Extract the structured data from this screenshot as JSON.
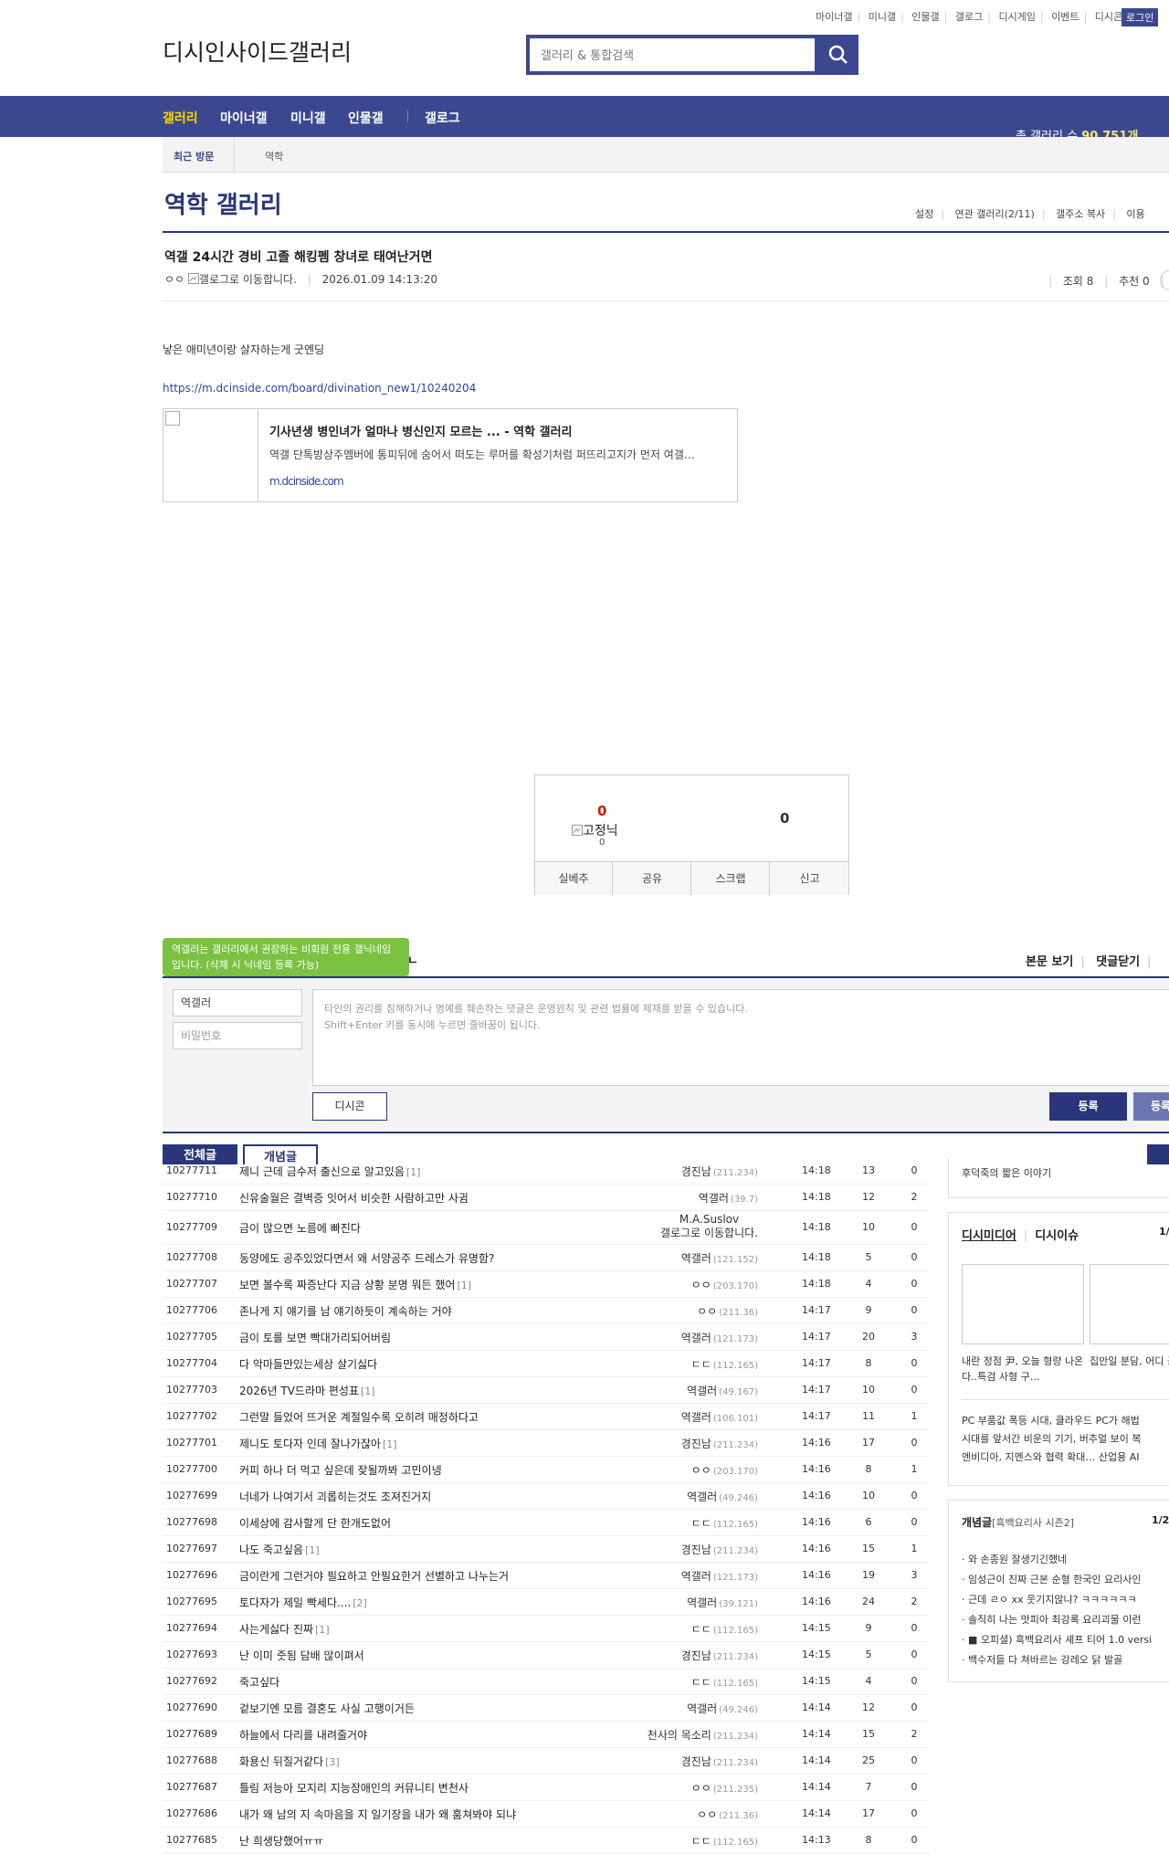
{
  "top_links": [
    "마이너갤",
    "미니갤",
    "인물갤",
    "갤로그",
    "디시게임",
    "이벤트",
    "디시콘"
  ],
  "login_label": "로그인",
  "logo_text": "디시인사이드갤러리",
  "search": {
    "placeholder": "갤러리 & 통합검색"
  },
  "nav": {
    "items": [
      "갤러리",
      "마이너갤",
      "미니갤",
      "인물갤",
      "갤로그"
    ],
    "gallery_count_label": "총 갤러리 수",
    "gallery_count": "90,751개"
  },
  "recent": {
    "label": "최근 방문",
    "value": "역학"
  },
  "gallery_title": "역학 갤러리",
  "title_links": [
    "설정",
    "연관 갤러리(2/11)",
    "갤주소 복사",
    "이용"
  ],
  "post": {
    "title": "역갤 24시간 경비 고졸 해킹펨 창녀로 태여난거면",
    "writer": "ㅇㅇ",
    "gallog_alt": "갤로그로 이동합니다.",
    "date": "2026.01.09 14:13:20",
    "views": "조회 8",
    "recommend": "추천 0",
    "body": "낳은 애미년이랑 살자하는게 굿엔딩",
    "link": "https://m.dcinside.com/board/divination_new1/10240204",
    "og": {
      "title": "기사년생 병인녀가 얼마나 병신인지 모르는 ... - 역학 갤러리",
      "desc": "역갤 단톡방상주멤버에 통피뒤에 숨어서 떠도는 루머를 확성기처럼 퍼뜨리고지가 먼저 여갤…",
      "domain": "m.dcinside.com"
    }
  },
  "recommend_box": {
    "up": "0",
    "fixed_alt": "고정닉",
    "fixed_count": "0",
    "down": "0",
    "buttons": [
      "실베추",
      "공유",
      "스크랩",
      "신고"
    ]
  },
  "comment": {
    "tooltip": "역갤러는 갤러리에서 권장하는 비회원 전용 갤닉네임입니다. (삭제 시 닉네임 등록 가능)",
    "tail": "ㄴ",
    "right_links": [
      "본문 보기",
      "댓글닫기"
    ],
    "nick_value": "역갤러",
    "pw_placeholder": "비밀번호",
    "textarea_line1": "타인의 권리를 침해하거나 명예를 훼손하는 댓글은 운영원칙 및 관련 법률에 제재를 받을 수 있습니다.",
    "textarea_line2": "Shift+Enter 키를 동시에 누르면 줄바꿈이 됩니다.",
    "dccon_label": "디시콘",
    "submit_label": "등록",
    "submit2_label": "등록"
  },
  "list_tabs": {
    "all": "전체글",
    "best": "개념글"
  },
  "list": [
    {
      "no": "10277711",
      "title": "제니 근데 금수저 출신으로 알고있음",
      "reply": "[1]",
      "writer": "경진남",
      "ip": "(211.234)",
      "date": "14:18",
      "views": "13",
      "rec": "0"
    },
    {
      "no": "10277710",
      "title": "신유술월은 결벽증 잇어서 비슷한 사람하고만 사귐",
      "reply": "",
      "writer": "역갤러",
      "ip": "(39.7)",
      "date": "14:18",
      "views": "12",
      "rec": "2"
    },
    {
      "no": "10277709",
      "title": "금이 많으면 노름에 빠진다",
      "reply": "",
      "writer": "M.A.Suslov",
      "ip": "",
      "writer2": "갤로그로 이동합니다.",
      "date": "14:18",
      "views": "10",
      "rec": "0",
      "tall": true
    },
    {
      "no": "10277708",
      "title": "동양에도 공주있었다면서 왜 서양공주 드레스가 유명함?",
      "reply": "",
      "writer": "역갤러",
      "ip": "(121.152)",
      "date": "14:18",
      "views": "5",
      "rec": "0"
    },
    {
      "no": "10277707",
      "title": "보면 볼수록 짜증난다 지금 상황 분명 뭐든 했어",
      "reply": "[1]",
      "writer": "ㅇㅇ",
      "ip": "(203.170)",
      "date": "14:18",
      "views": "4",
      "rec": "0"
    },
    {
      "no": "10277706",
      "title": " 존나게 지 얘기를 남 얘기하듯이 계속하는 거야",
      "reply": "",
      "writer": "ㅇㅇ",
      "ip": "(211.36)",
      "date": "14:17",
      "views": "9",
      "rec": "0"
    },
    {
      "no": "10277705",
      "title": "금이 토를 보면 빡대가리되어버림",
      "reply": "",
      "writer": "역갤러",
      "ip": "(121.173)",
      "date": "14:17",
      "views": "20",
      "rec": "3"
    },
    {
      "no": "10277704",
      "title": "다 악마들만있는세상 살기싫다",
      "reply": "",
      "writer": "ㄷㄷ",
      "ip": "(112.165)",
      "date": "14:17",
      "views": "8",
      "rec": "0"
    },
    {
      "no": "10277703",
      "title": "2026년 TV드라마 편성표",
      "reply": "[1]",
      "writer": "역갤러",
      "ip": "(49.167)",
      "date": "14:17",
      "views": "10",
      "rec": "0"
    },
    {
      "no": "10277702",
      "title": " 그런말 들었어 뜨거운 계절일수록 오히려 매정하다고",
      "reply": "",
      "writer": "역갤러",
      "ip": "(106.101)",
      "date": "14:17",
      "views": "11",
      "rec": "1"
    },
    {
      "no": "10277701",
      "title": "제니도 토다자 인데 잘나가잖아",
      "reply": "[1]",
      "writer": "경진남",
      "ip": "(211.234)",
      "date": "14:16",
      "views": "17",
      "rec": "0"
    },
    {
      "no": "10277700",
      "title": "커피 하나 더 먹고 싶은데 잦될까봐 고민이넹",
      "reply": "",
      "writer": "ㅇㅇ",
      "ip": "(203.170)",
      "date": "14:16",
      "views": "8",
      "rec": "1"
    },
    {
      "no": "10277699",
      "title": "너네가 나여기서 괴롭히는것도 조져진거지",
      "reply": "",
      "writer": "역갤러",
      "ip": "(49.246)",
      "date": "14:16",
      "views": "10",
      "rec": "0"
    },
    {
      "no": "10277698",
      "title": "이세상에 감사할게 단 한개도없어",
      "reply": "",
      "writer": "ㄷㄷ",
      "ip": "(112.165)",
      "date": "14:16",
      "views": "6",
      "rec": "0"
    },
    {
      "no": "10277697",
      "title": "나도 죽고싶음",
      "reply": "[1]",
      "writer": "경진남",
      "ip": "(211.234)",
      "date": "14:16",
      "views": "15",
      "rec": "1"
    },
    {
      "no": "10277696",
      "title": "금이란게 그런거야 필요하고 안필요한거 선별하고 나누는거",
      "reply": "",
      "writer": "역갤러",
      "ip": "(121.173)",
      "date": "14:16",
      "views": "19",
      "rec": "3"
    },
    {
      "no": "10277695",
      "title": "토다자가 제일 빡세다....",
      "reply": "[2]",
      "writer": "역갤러",
      "ip": "(39.121)",
      "date": "14:16",
      "views": "24",
      "rec": "2"
    },
    {
      "no": "10277694",
      "title": "사는게싫다 진짜",
      "reply": "[1]",
      "writer": "ㄷㄷ",
      "ip": "(112.165)",
      "date": "14:15",
      "views": "9",
      "rec": "0"
    },
    {
      "no": "10277693",
      "title": "난 이미 줏됨 담배 많이펴서",
      "reply": "",
      "writer": "경진남",
      "ip": "(211.234)",
      "date": "14:15",
      "views": "5",
      "rec": "0"
    },
    {
      "no": "10277692",
      "title": "죽고싶다",
      "reply": "",
      "writer": "ㄷㄷ",
      "ip": "(112.165)",
      "date": "14:15",
      "views": "4",
      "rec": "0"
    },
    {
      "no": "10277690",
      "title": "겉보기엔 모름 결혼도 사실 고행이거든",
      "reply": "",
      "writer": "역갤러",
      "ip": "(49.246)",
      "date": "14:14",
      "views": "12",
      "rec": "0"
    },
    {
      "no": "10277689",
      "title": "하늘에서 다리를 내려줄거야",
      "reply": "",
      "writer": "천사의 목소리",
      "ip": "(211.234)",
      "date": "14:14",
      "views": "15",
      "rec": "2"
    },
    {
      "no": "10277688",
      "title": "화용신 뒤질거같다",
      "reply": "[3]",
      "writer": "경진남",
      "ip": "(211.234)",
      "date": "14:14",
      "views": "25",
      "rec": "0"
    },
    {
      "no": "10277687",
      "title": "틀림 저능아 모지리 지능장애인의 커뮤니티 변천사",
      "reply": "",
      "writer": "ㅇㅇ",
      "ip": "(211.235)",
      "date": "14:14",
      "views": "7",
      "rec": "0"
    },
    {
      "no": "10277686",
      "title": "내가 왜 남의 지 속마음을 지 일기장을 내가 왜 훔쳐봐야 되냐",
      "reply": "",
      "writer": "ㅇㅇ",
      "ip": "(211.36)",
      "date": "14:14",
      "views": "17",
      "rec": "0"
    },
    {
      "no": "10277685",
      "title": "난 희생당했어ㅠㅠ",
      "reply": "",
      "writer": "ㄷㄷ",
      "ip": "(112.165)",
      "date": "14:13",
      "views": "8",
      "rec": "0"
    }
  ],
  "sidebar": {
    "box1_text": "후덕죽의 짧은 이야기",
    "media_tabs": [
      "디시미디어",
      "디시이슈"
    ],
    "media_page": "1/",
    "media_cap1": "내란 정점 尹, 오늘 형량 나온다..특검 사형 구…",
    "media_cap2": "집안일 분담, 어디 공평일까?",
    "media_news": [
      "PC 부품값 폭등 시대, 클라우드 PC가 해법",
      "시대를 앞서간 비운의 기기, 버추얼 보이 복",
      "엔비디아, 지멘스와 협력 확대… 산업용 AI"
    ],
    "best_title": "개념글",
    "best_sub": "[흑백요리사 시즌2]",
    "best_page": "1/2",
    "best_items": [
      "와 손종원 잘생기긴했네",
      "임성근이 진짜 근본 순혈 한국인 요리사인",
      "근데 ㄹㅇ xx 웃기지않냐? ㅋㅋㅋㅋㅋㅋ",
      "솔직히 나는 맛피아 최강록 요리괴물 이런",
      "■ 오피셜) 흑백요리사 셰프 티어 1.0 versi",
      "백수저들 다 쳐바르는 강레오 닭 발골"
    ]
  }
}
